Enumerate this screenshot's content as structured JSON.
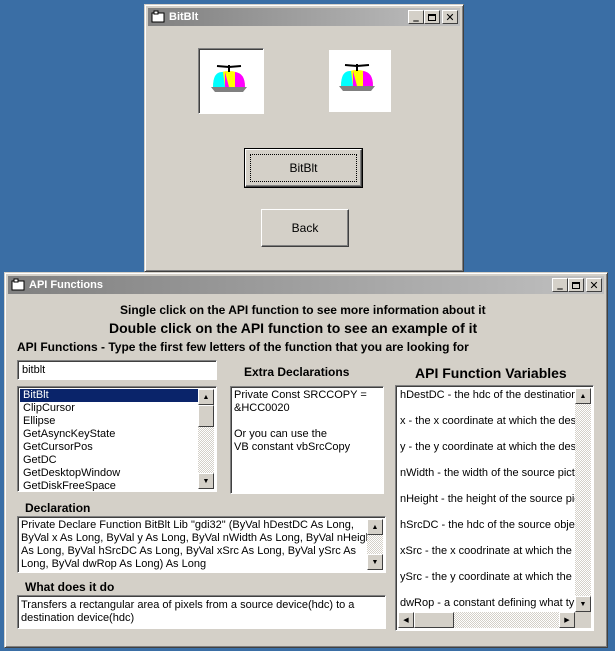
{
  "bitblt_window": {
    "title": "BitBlt",
    "bitblt_button": "BitBlt",
    "back_button": "Back"
  },
  "api_window": {
    "title": "API Functions",
    "instruction_single": "Single click on the API function to see more information about it",
    "instruction_double": "Double click on the API function to see an example of it",
    "functions_label": "API Functions - Type the first few letters of the function that you are looking for",
    "search_value": "bitblt",
    "functions": [
      "BitBlt",
      "ClipCursor",
      "Ellipse",
      "GetAsyncKeyState",
      "GetCursorPos",
      "GetDC",
      "GetDesktopWindow",
      "GetDiskFreeSpace"
    ],
    "selected_function": "BitBlt",
    "extra_declarations_label": "Extra Declarations",
    "extra_declarations": [
      "Private Const SRCCOPY =",
      "&HCC0020",
      "",
      " Or you can use the",
      "   VB constant vbSrcCopy"
    ],
    "declaration_label": "Declaration",
    "declaration_lines": [
      "Private Declare Function BitBlt Lib \"gdi32\" (ByVal hDestDC As Long,",
      "ByVal x As Long, ByVal y As Long, ByVal nWidth As Long, ByVal nHeight",
      "As Long, ByVal hSrcDC As Long, ByVal xSrc As Long, ByVal ySrc As",
      "Long, ByVal dwRop As Long) As Long"
    ],
    "what_label": "What does it do",
    "what_lines": [
      "Transfers a rectangular area of pixels from a source device(hdc) to a",
      "destination device(hdc)"
    ],
    "variables_label": "API Function Variables",
    "variables": [
      "hDestDC - the hdc of the destination c",
      "x - the x coordinate at which the desti",
      "y - the y coordinate at which the desti",
      "nWidth - the width of the source pictu",
      "nHeight - the height of the source pict",
      "hSrcDC - the hdc of the source object",
      "xSrc - the x coodrinate at which the pi",
      "ySrc - the y coordinate at which the pi",
      "dwRop - a constant defining what type"
    ]
  },
  "colors": {
    "desktop": "#3a6ea5",
    "face": "#d4d0c8",
    "active_title": "#0a246a",
    "selection": "#0a246a"
  }
}
